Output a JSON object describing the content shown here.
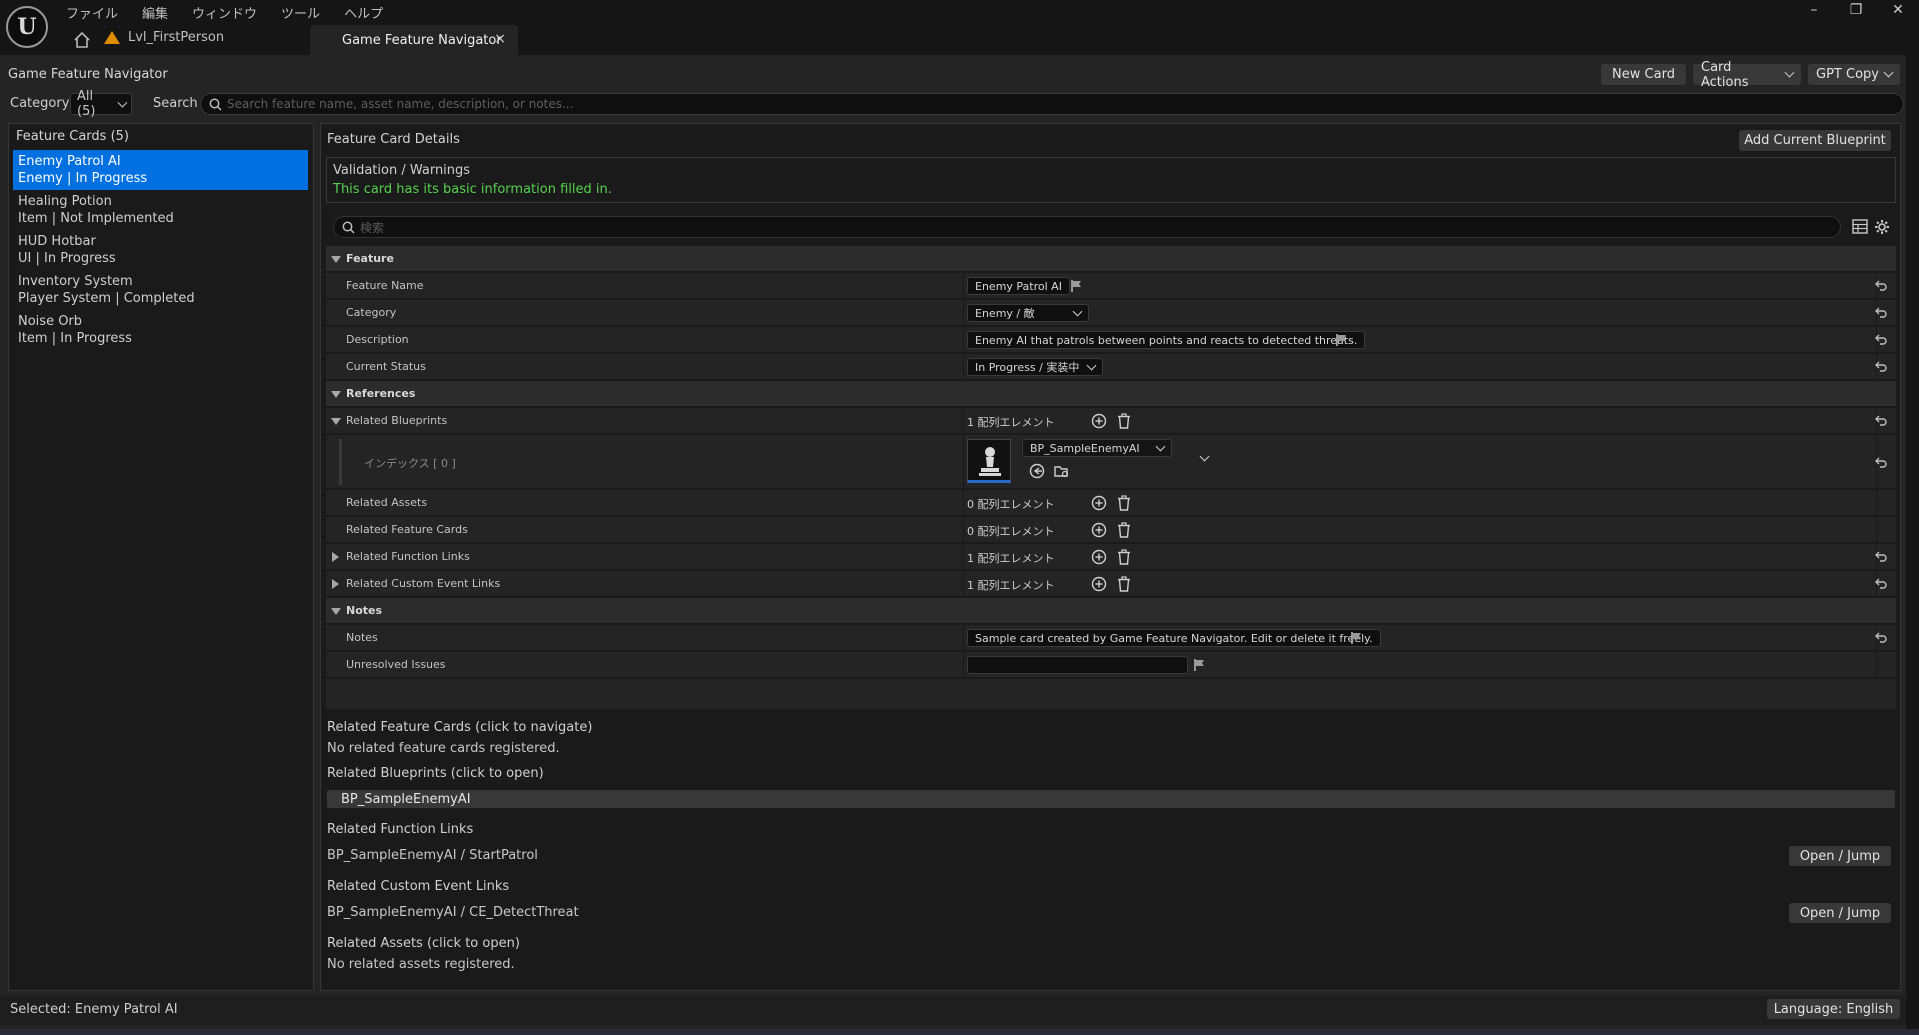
{
  "titlebar": {
    "menu": [
      "ファイル",
      "編集",
      "ウィンドウ",
      "ツール",
      "ヘルプ"
    ],
    "level_tab": "Lvl_FirstPerson",
    "active_tab": "Game Feature Navigator",
    "close_glyph": "×"
  },
  "toolbar": {
    "panel_title": "Game Feature Navigator",
    "new_card": "New Card",
    "card_actions": "Card Actions",
    "gpt_copy": "GPT Copy"
  },
  "filter": {
    "category_label": "Category",
    "category_value": "All (5)",
    "search_label": "Search",
    "search_placeholder": "Search feature name, asset name, description, or notes..."
  },
  "cards": {
    "title": "Feature Cards (5)",
    "items": [
      {
        "name": "Enemy Patrol AI",
        "meta": "Enemy  |  In Progress",
        "selected": true
      },
      {
        "name": "Healing Potion",
        "meta": "Item  |  Not Implemented",
        "selected": false
      },
      {
        "name": "HUD Hotbar",
        "meta": "UI  |  In Progress",
        "selected": false
      },
      {
        "name": "Inventory System",
        "meta": "Player System  |  Completed",
        "selected": false
      },
      {
        "name": "Noise Orb",
        "meta": "Item  |  In Progress",
        "selected": false
      }
    ]
  },
  "details": {
    "title": "Feature Card Details",
    "add_bp_button": "Add Current Blueprint",
    "validation_title": "Validation / Warnings",
    "validation_msg": "This card has its basic information filled in.",
    "prop_search_placeholder": "検索",
    "sections": {
      "feature": "Feature",
      "references": "References",
      "notes": "Notes"
    },
    "props": {
      "feature_name_label": "Feature Name",
      "feature_name": "Enemy Patrol AI",
      "category_label": "Category",
      "category": "Enemy / 敵",
      "description_label": "Description",
      "description": "Enemy AI that patrols between points and reacts to detected threats.",
      "status_label": "Current Status",
      "status": "In Progress / 実装中",
      "related_bp_label": "Related Blueprints",
      "related_bp_count": "1 配列エレメント",
      "index_label": "インデックス [ 0 ]",
      "bp_value": "BP_SampleEnemyAI",
      "related_assets_label": "Related Assets",
      "related_assets_count": "0 配列エレメント",
      "related_cards_label": "Related Feature Cards",
      "related_cards_count": "0 配列エレメント",
      "func_links_label": "Related Function Links",
      "func_links_count": "1 配列エレメント",
      "event_links_label": "Related Custom Event Links",
      "event_links_count": "1 配列エレメント",
      "notes_label": "Notes",
      "notes": "Sample card created by Game Feature Navigator. Edit or delete it freely.",
      "unresolved_label": "Unresolved Issues",
      "unresolved": ""
    }
  },
  "lower": {
    "rel_cards_h": "Related Feature Cards (click to navigate)",
    "rel_cards_t": "No related feature cards registered.",
    "rel_bp_h": "Related Blueprints (click to open)",
    "rel_bp_item": "BP_SampleEnemyAI",
    "func_h": "Related Function Links",
    "func_item": "BP_SampleEnemyAI / StartPatrol",
    "event_h": "Related Custom Event Links",
    "event_item": "BP_SampleEnemyAI / CE_DetectThreat",
    "jump": "Open / Jump",
    "assets_h": "Related Assets (click to open)",
    "assets_t": "No related assets registered."
  },
  "status": {
    "selected": "Selected: Enemy Patrol AI",
    "language": "Language: English"
  },
  "colors": {
    "accent": "#0070e0",
    "ok": "#55d34d",
    "warn": "#e08a00"
  }
}
